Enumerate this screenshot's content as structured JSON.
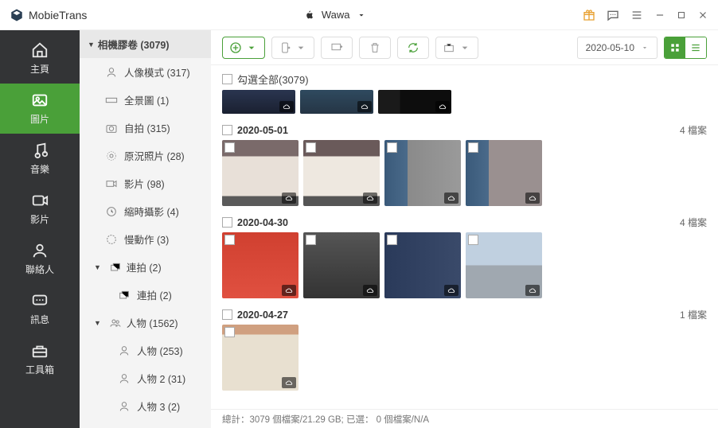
{
  "app_name": "MobieTrans",
  "device_name": "Wawa",
  "nav": {
    "home": "主頁",
    "photos": "圖片",
    "music": "音樂",
    "videos": "影片",
    "contacts": "聯絡人",
    "messages": "訊息",
    "toolbox": "工具箱"
  },
  "sidebar": {
    "camera_roll": "相機膠卷 (3079)",
    "portrait": "人像模式 (317)",
    "panorama": "全景圖 (1)",
    "selfie": "自拍 (315)",
    "original": "原況照片 (28)",
    "video": "影片 (98)",
    "timelapse": "縮時攝影 (4)",
    "slomo": "慢動作 (3)",
    "burst_group": "連拍 (2)",
    "burst_item": "連拍 (2)",
    "people_group": "人物 (1562)",
    "people1": "人物 (253)",
    "people2": "人物 2 (31)",
    "people3": "人物 3 (2)"
  },
  "toolbar": {
    "date": "2020-05-10"
  },
  "select_all": "勾選全部(3079)",
  "sections": [
    {
      "date": "2020-05-01",
      "count": "4 檔案",
      "photos": 4
    },
    {
      "date": "2020-04-30",
      "count": "4 檔案",
      "photos": 4
    },
    {
      "date": "2020-04-27",
      "count": "1 檔案",
      "photos": 1
    }
  ],
  "status": "總計：3079 個檔案/21.29 GB; 已選： 0 個檔案/N/A"
}
